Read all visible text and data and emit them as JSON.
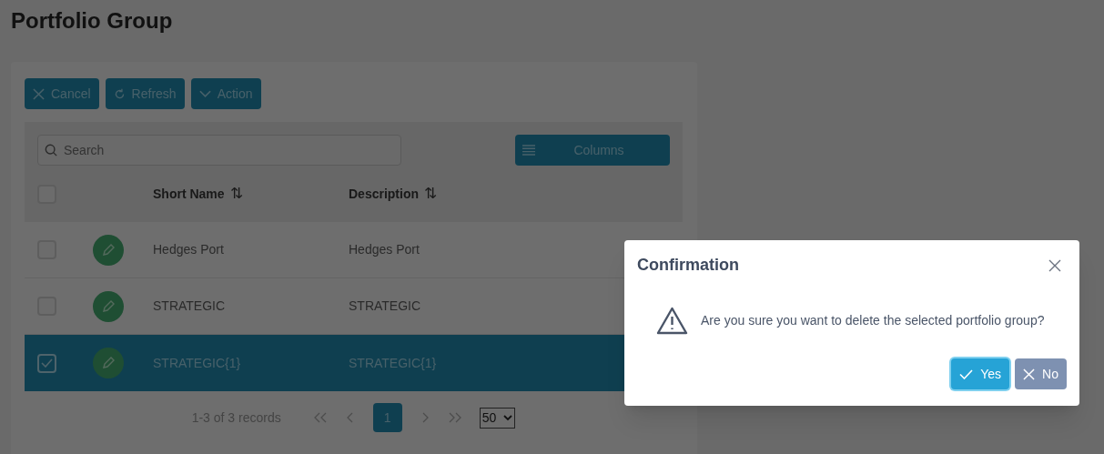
{
  "page_title": "Portfolio Group",
  "toolbar": [
    {
      "kind": "cancel",
      "label": "Cancel"
    },
    {
      "kind": "refresh",
      "label": "Refresh"
    },
    {
      "kind": "action",
      "label": "Action"
    }
  ],
  "search": {
    "placeholder": "Search"
  },
  "columns_button": {
    "label": "Columns"
  },
  "table": {
    "select_all": {
      "checked": false
    },
    "columns": [
      {
        "label": "Short Name",
        "sort_icon": "⇅"
      },
      {
        "label": "Description",
        "sort_icon": "⇅"
      }
    ],
    "rows": [
      {
        "short_name": "Hedges Port",
        "description": "Hedges Port",
        "selected": false
      },
      {
        "short_name": "STRATEGIC",
        "description": "STRATEGIC",
        "selected": false
      },
      {
        "short_name": "STRATEGIC{1}",
        "description": "STRATEGIC{1}",
        "selected": true
      }
    ]
  },
  "pagination": {
    "summary": "1-3 of 3 records",
    "pages": [
      {
        "label": "1",
        "selected": true
      }
    ],
    "page_size": "50"
  },
  "dialog": {
    "title": "Confirmation",
    "message": "Are you sure you want to delete the selected portfolio group?",
    "buttons": [
      {
        "kind": "yes",
        "label": "Yes"
      },
      {
        "kind": "no",
        "label": "No"
      }
    ]
  }
}
